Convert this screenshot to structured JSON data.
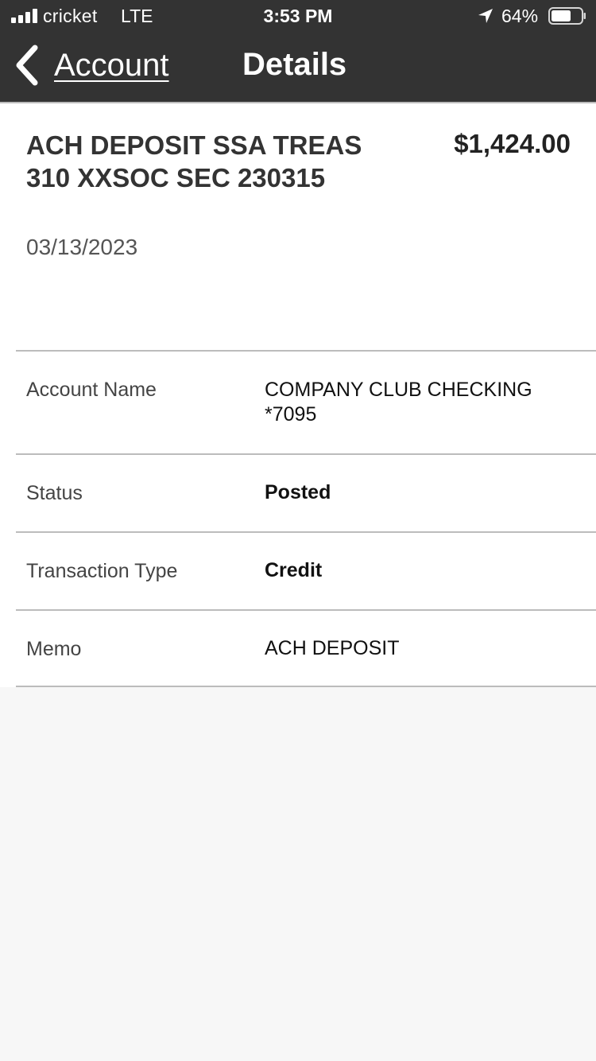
{
  "status_bar": {
    "carrier": "cricket",
    "network": "LTE",
    "time": "3:53 PM",
    "battery_percent": "64%",
    "battery_level": 0.64,
    "signal_bars": 4,
    "icons": [
      "signal-bars-icon",
      "location-arrow-icon",
      "battery-icon"
    ]
  },
  "nav": {
    "back_label": "Account",
    "title": "Details",
    "back_icon": "chevron-left-icon"
  },
  "transaction": {
    "description": "ACH DEPOSIT SSA TREAS 310 XXSOC SEC 230315",
    "date": "03/13/2023",
    "amount": "$1,424.00"
  },
  "details": [
    {
      "label": "Account Name",
      "value": "COMPANY CLUB CHECKING *7095"
    },
    {
      "label": "Status",
      "value": "Posted"
    },
    {
      "label": "Transaction Type",
      "value": "Credit"
    },
    {
      "label": "Memo",
      "value": "ACH DEPOSIT"
    }
  ],
  "colors": {
    "header_bg": "#333333",
    "content_bg": "#ffffff",
    "page_bg": "#f7f7f7",
    "divider": "#bcbcbc"
  }
}
